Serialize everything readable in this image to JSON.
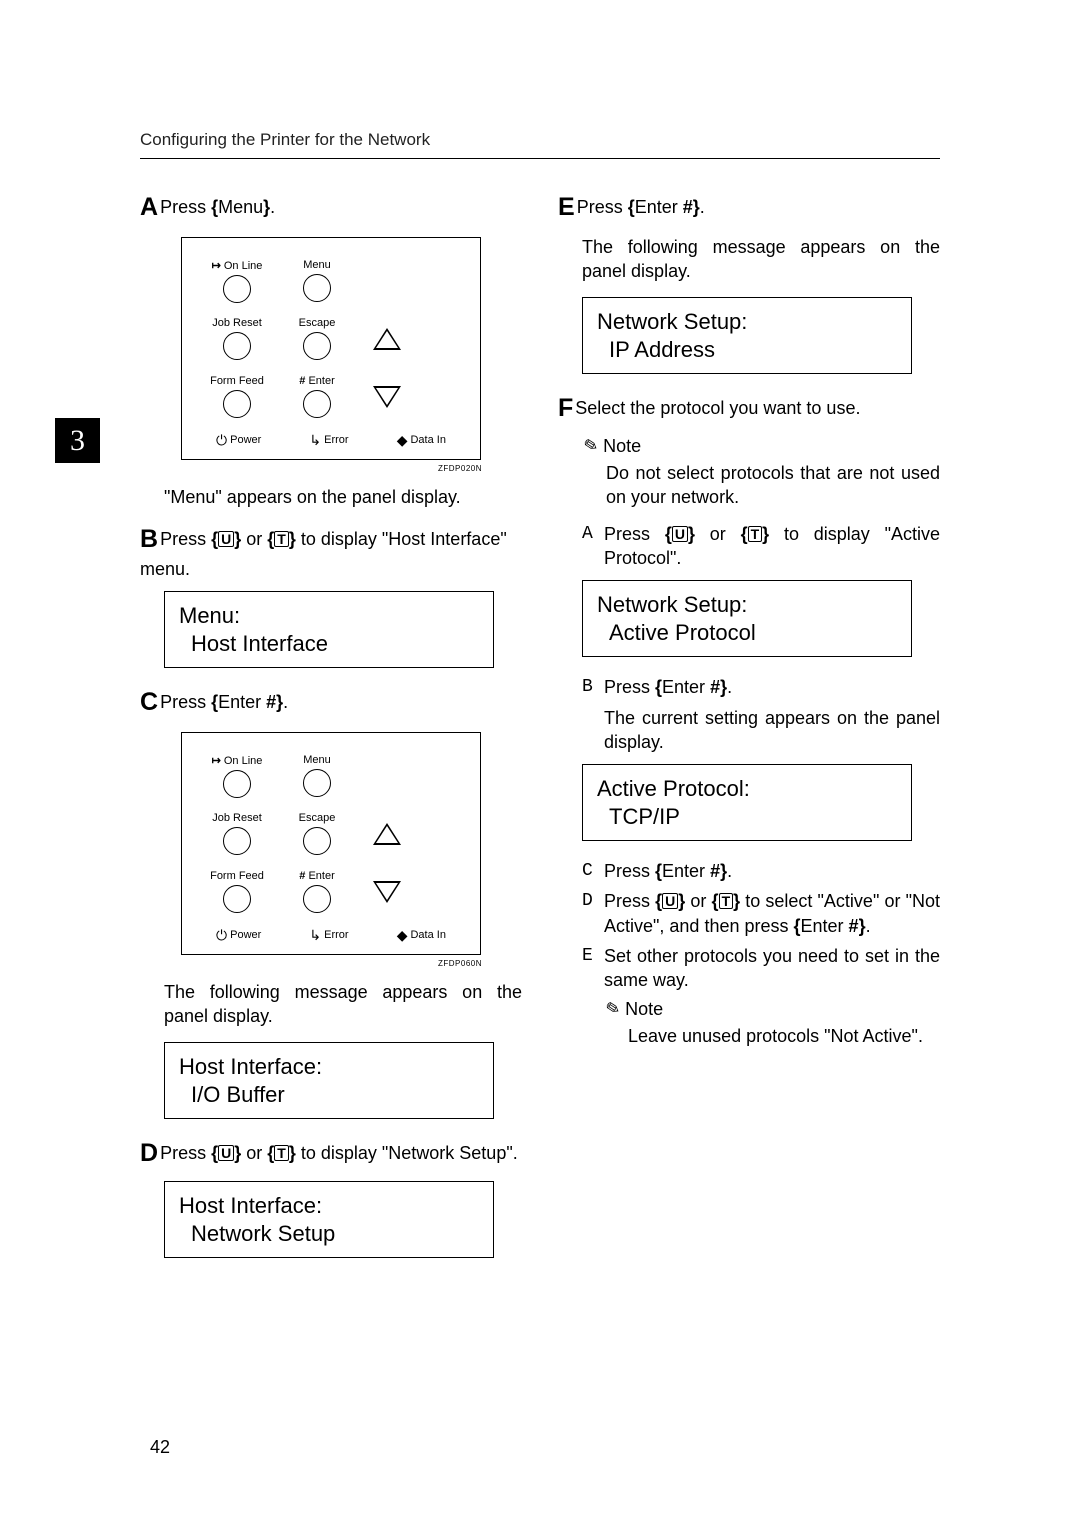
{
  "running_head": "Configuring the Printer for the Network",
  "chapter_tab": "3",
  "page_number": "42",
  "panel_labels": {
    "online": "On Line",
    "menu": "Menu",
    "job_reset": "Job Reset",
    "escape": "Escape",
    "form_feed": "Form Feed",
    "enter": "Enter",
    "power": "Power",
    "error": "Error",
    "data_in": "Data In"
  },
  "fig_ids": {
    "a": "ZFDP020N",
    "c": "ZFDP060N"
  },
  "left": {
    "A": {
      "letter": "A",
      "text_pre": "Press ",
      "key": "Menu",
      "text_post": "."
    },
    "A_after": "\"Menu\" appears on the panel display.",
    "B": {
      "letter": "B",
      "text": "Press {U} or {T} to display \"Host Interface\" menu."
    },
    "lcd_B_line1": "Menu:",
    "lcd_B_line2": "Host Interface",
    "C": {
      "letter": "C",
      "text_pre": "Press ",
      "key": "Enter",
      "text_post": "."
    },
    "C_after": "The following message appears on the panel display.",
    "lcd_C_line1": "Host Interface:",
    "lcd_C_line2": "I/O Buffer",
    "D": {
      "letter": "D",
      "text": "Press {U} or {T} to display \"Network Setup\"."
    },
    "lcd_D_line1": "Host Interface:",
    "lcd_D_line2": "Network Setup"
  },
  "right": {
    "E": {
      "letter": "E",
      "text_pre": "Press ",
      "key": "Enter",
      "text_post": "."
    },
    "E_after": "The following message appears on the panel display.",
    "lcd_E_line1": "Network Setup:",
    "lcd_E_line2": "IP Address",
    "F": {
      "letter": "F",
      "text": "Select the protocol you want to use."
    },
    "note1_head": "Note",
    "note1_body": "Do not select protocols that are not used on your network.",
    "subA": {
      "letter": "A",
      "text": "Press {U} or {T} to display \"Active Protocol\"."
    },
    "lcd_subA_line1": "Network Setup:",
    "lcd_subA_line2": "Active Protocol",
    "subB": {
      "letter": "B",
      "text_pre": "Press ",
      "key": "Enter",
      "text_post": "."
    },
    "subB_after": "The current setting appears on the panel display.",
    "lcd_subB_line1": "Active Protocol:",
    "lcd_subB_line2": "TCP/IP",
    "subC": {
      "letter": "C",
      "text_pre": "Press ",
      "key": "Enter",
      "text_post": "."
    },
    "subD": {
      "letter": "D",
      "text": "Press {U} or {T} to select \"Active\" or \"Not Active\", and then press {Enter}."
    },
    "subE": {
      "letter": "E",
      "text": "Set other protocols you need to set in the same way."
    },
    "note2_head": "Note",
    "note2_body": "Leave unused protocols \"Not Active\"."
  }
}
